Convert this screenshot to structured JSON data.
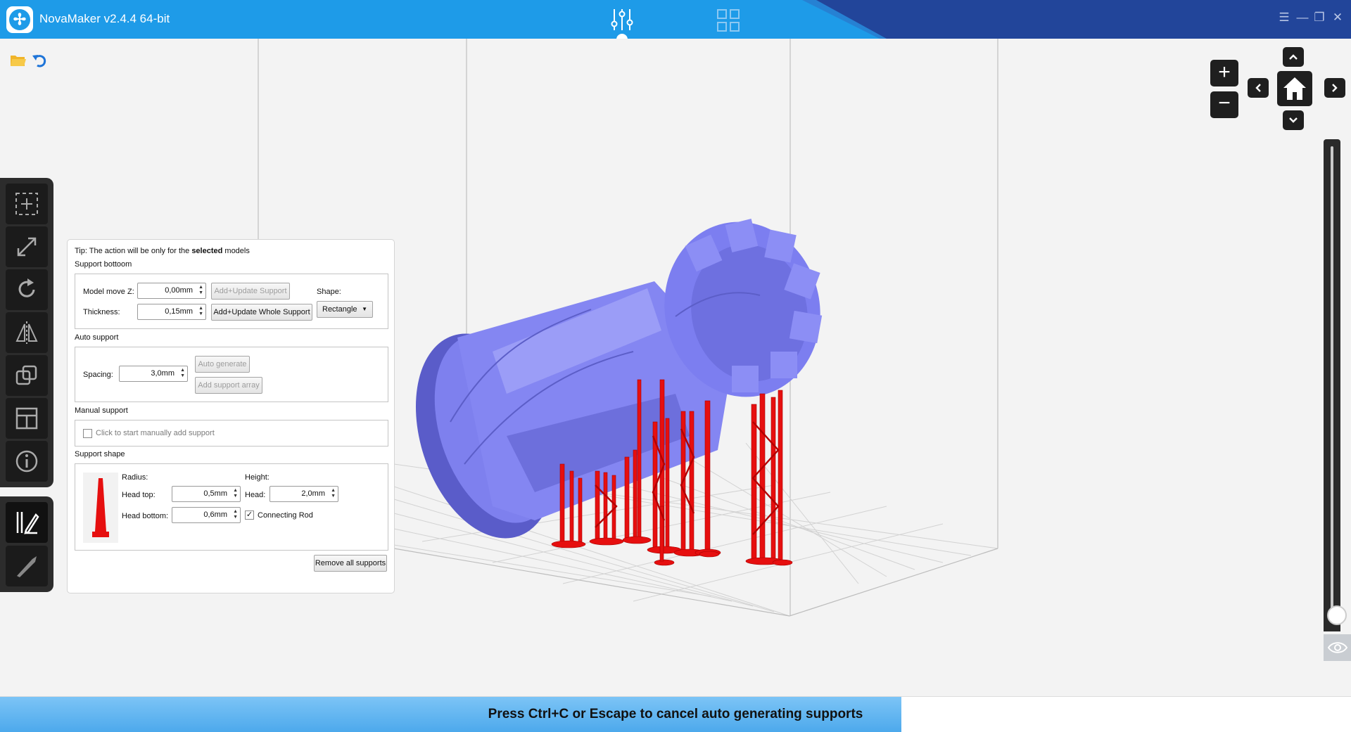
{
  "app": {
    "title": "NovaMaker v2.4.4 64-bit"
  },
  "window_controls": {
    "menu": "☰",
    "minimize": "—",
    "restore": "❐",
    "close": "✕"
  },
  "panel": {
    "tip_prefix": "Tip: The action will be only for the ",
    "tip_bold": "selected",
    "tip_suffix": " models",
    "support_bottom": {
      "title": "Support bottoom",
      "model_move_z_label": "Model move Z:",
      "model_move_z_value": "0,00mm",
      "thickness_label": "Thickness:",
      "thickness_value": "0,15mm",
      "add_update_support": "Add+Update Support",
      "add_update_whole_support": "Add+Update Whole Support",
      "shape_label": "Shape:",
      "shape_value": "Rectangle"
    },
    "auto_support": {
      "title": "Auto support",
      "spacing_label": "Spacing:",
      "spacing_value": "3,0mm",
      "auto_generate": "Auto generate",
      "add_support_array": "Add support array"
    },
    "manual_support": {
      "title": "Manual support",
      "checkbox_label": "Click to start manually add support"
    },
    "support_shape": {
      "title": "Support shape",
      "radius_label": "Radius:",
      "height_label": "Height:",
      "head_top_label": "Head top:",
      "head_top_value": "0,5mm",
      "head_label": "Head:",
      "head_value": "2,0mm",
      "head_bottom_label": "Head bottom:",
      "head_bottom_value": "0,6mm",
      "connecting_rod_label": "Connecting Rod",
      "connecting_rod_checked": "✓"
    },
    "remove_all_supports": "Remove all supports"
  },
  "status": {
    "message": "Press Ctrl+C or Escape to cancel auto generating supports",
    "progress_fraction": 0.667
  },
  "colors": {
    "titlebar": "#1e9be8",
    "titlebar_dark": "#22459a",
    "model": "#7b7df0",
    "support": "#e60f0f"
  }
}
